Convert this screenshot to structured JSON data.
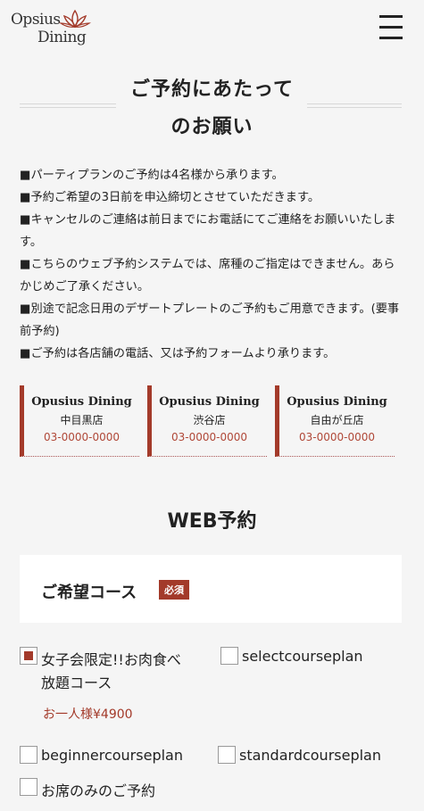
{
  "header": {
    "logo_line1": "Opsius",
    "logo_line2": "Dining",
    "logo_icon": "lotus-icon",
    "menu_icon": "hamburger-icon"
  },
  "title": {
    "line1": "ご予約にあたって",
    "line2": "のお願い"
  },
  "notes": [
    "■パーティプランのご予約は4名様から承ります。",
    "■予約ご希望の3日前を申込締切とさせていただきます。",
    "■キャンセルのご連絡は前日までにお電話にてご連絡をお願いいたします。",
    "■こちらのウェブ予約システムでは、席種のご指定はできません。あらかじめご了承ください。",
    "■別途で記念日用のデザートプレートのご予約もご用意できます。(要事前予約)",
    "■ご予約は各店舗の電話、又は予約フォームより承ります。"
  ],
  "stores": [
    {
      "name": "Opusius Dining",
      "branch": "中目黒店",
      "tel": "03-0000-0000"
    },
    {
      "name": "Opusius Dining",
      "branch": "渋谷店",
      "tel": "03-0000-0000"
    },
    {
      "name": "Opusius Dining",
      "branch": "自由が丘店",
      "tel": "03-0000-0000"
    }
  ],
  "web": {
    "title": "WEB予約"
  },
  "course": {
    "label": "ご希望コース",
    "required": "必須",
    "options": [
      {
        "label": "女子会限定!!お肉食べ放題コース",
        "checked": true
      },
      {
        "label": "selectcourseplan",
        "checked": false
      },
      {
        "label": "beginnercourseplan",
        "checked": false
      },
      {
        "label": "standardcourseplan",
        "checked": false
      },
      {
        "label": "お席のみのご予約",
        "checked": false
      }
    ],
    "price": "お一人様¥4900"
  },
  "colors": {
    "accent": "#a33a2a",
    "background": "#f5f5f5"
  }
}
